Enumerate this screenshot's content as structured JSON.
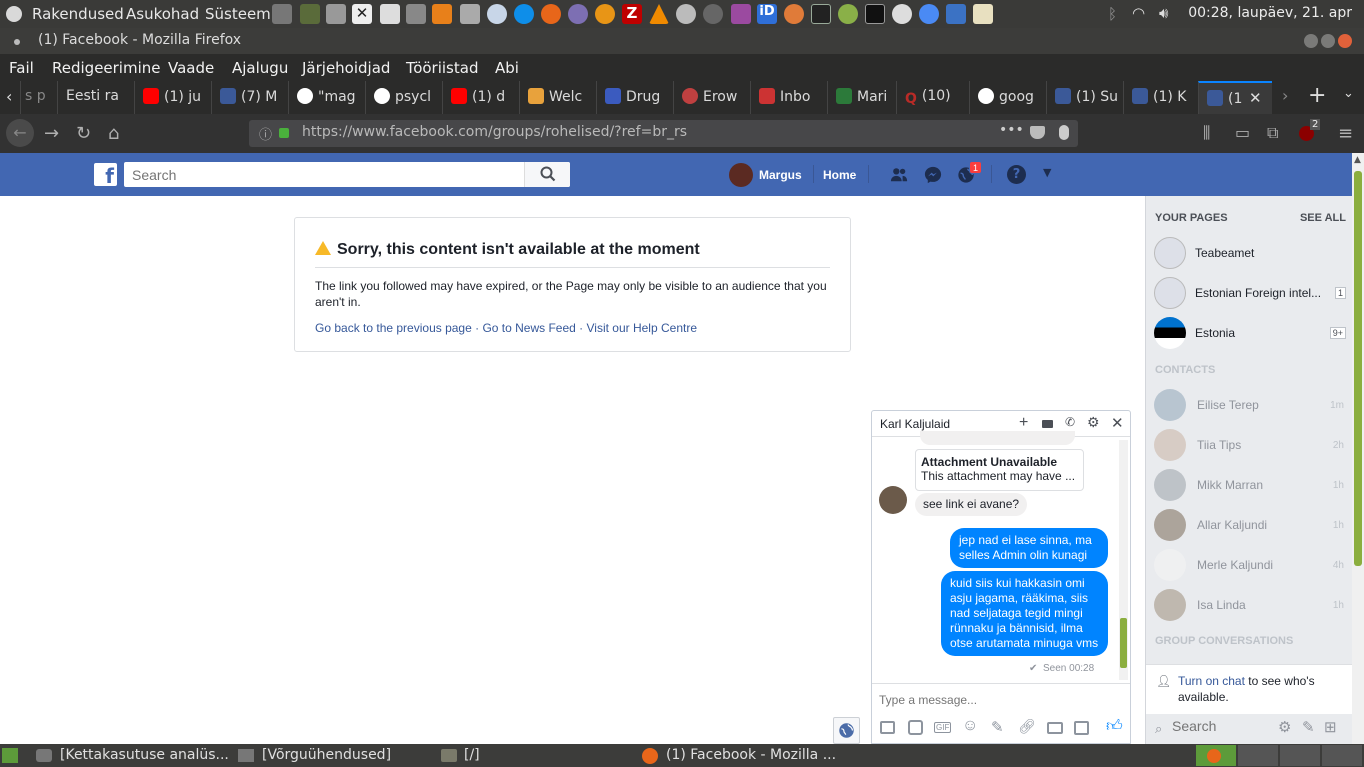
{
  "system_panel": {
    "menus": [
      "Rakendused",
      "Asukohad",
      "Süsteem"
    ],
    "clock": "00:28, laupäev, 21. apr"
  },
  "window": {
    "title": "(1) Facebook - Mozilla Firefox"
  },
  "menubar": [
    "Fail",
    "Redigeerimine",
    "Vaade",
    "Ajalugu",
    "Järjehoidjad",
    "Tööriistad",
    "Abi"
  ],
  "tabs": [
    {
      "label": "s p"
    },
    {
      "label": "Eesti ra"
    },
    {
      "label": "(1) ju"
    },
    {
      "label": "(7) M"
    },
    {
      "label": "\"mag"
    },
    {
      "label": "psycl"
    },
    {
      "label": "(1) d"
    },
    {
      "label": "Welc"
    },
    {
      "label": "Drug"
    },
    {
      "label": "Erow"
    },
    {
      "label": "Inbo"
    },
    {
      "label": "Mari"
    },
    {
      "label": "(10) "
    },
    {
      "label": "goog"
    },
    {
      "label": "(1) Su"
    },
    {
      "label": "(1) K"
    },
    {
      "label": "(1"
    }
  ],
  "nav": {
    "url": "https://www.facebook.com/groups/rohelised/?ref=br_rs",
    "library_badge": "2"
  },
  "fb_header": {
    "logo": "f",
    "search_placeholder": "Search",
    "user": "Margus",
    "home": "Home",
    "notif_count": "1"
  },
  "error": {
    "title": "Sorry, this content isn't available at the moment",
    "message": "The link you followed may have expired, or the Page may only be visible to an audience that you aren't in.",
    "link_back": "Go back to the previous page",
    "link_news": "Go to News Feed",
    "link_help": "Visit our Help Centre",
    "sep": " · "
  },
  "sidebar": {
    "your_pages": "YOUR PAGES",
    "see_all": "SEE ALL",
    "pages": [
      {
        "name": "Teabeamet",
        "badge": ""
      },
      {
        "name": "Estonian Foreign intel...",
        "badge": "1"
      },
      {
        "name": "Estonia",
        "badge": "9+"
      }
    ],
    "contacts_title": "CONTACTS",
    "contacts": [
      {
        "name": "Eilise Terep",
        "time": "1m"
      },
      {
        "name": "Tiia Tips",
        "time": "2h"
      },
      {
        "name": "Mikk Marran",
        "time": "1h"
      },
      {
        "name": "Allar Kaljundi",
        "time": "1h"
      },
      {
        "name": "Merle Kaljundi",
        "time": "4h"
      },
      {
        "name": "Isa Linda",
        "time": "1h"
      }
    ],
    "group_conv": "GROUP CONVERSATIONS",
    "turn_on_link": "Turn on chat",
    "turn_on_rest": " to see who's available.",
    "search_placeholder": "Search"
  },
  "chat": {
    "name": "Karl Kaljulaid",
    "attachment_title": "Attachment Unavailable",
    "attachment_text": "This attachment may have ...",
    "msg_them": "see link ei avane?",
    "msg_me1": "jep nad ei lase sinna, ma selles Admin olin kunagi",
    "msg_me2": "kuid siis kui hakkasin omi asju jagama, rääkima, siis nad seljataga tegid mingi rünnaku ja bännisid, ilma otse arutamata minuga vms",
    "seen": "Seen 00:28",
    "input_placeholder": "Type a message...",
    "gif": "GIF"
  },
  "taskbar": {
    "items": [
      "[Kettakasutuse analüs...",
      "[Võrguühendused]",
      "[/]",
      "(1) Facebook - Mozilla ..."
    ]
  },
  "colors": {
    "fb_blue": "#4267b2",
    "messenger_blue": "#0084ff",
    "link": "#365899"
  }
}
